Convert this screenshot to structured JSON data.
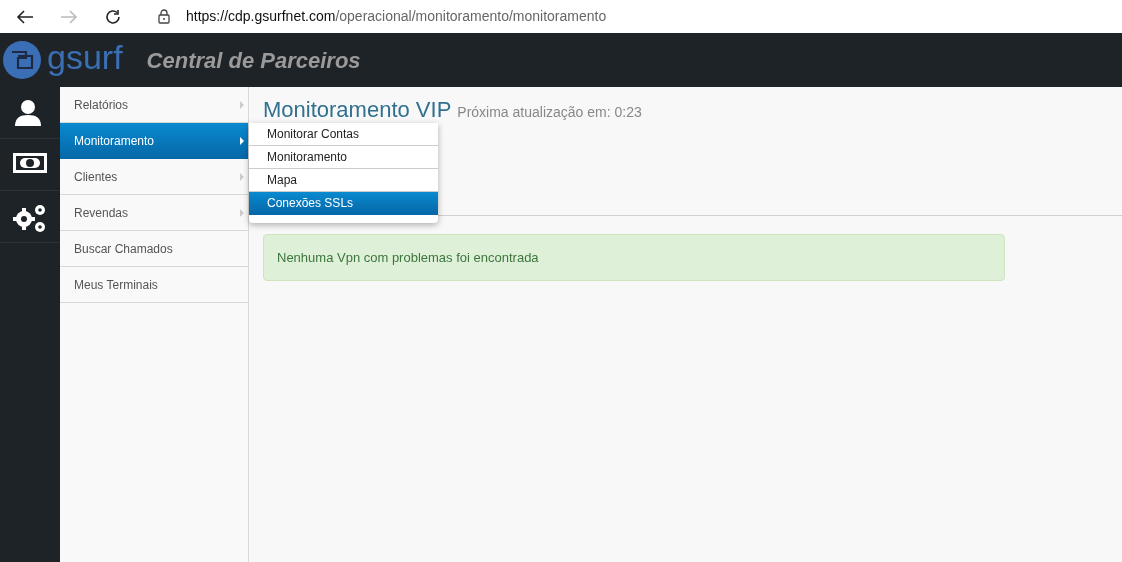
{
  "browser": {
    "url_host": "https://cdp.gsurfnet.com",
    "url_path": "/operacional/monitoramento/monitoramento"
  },
  "header": {
    "logo_text": "gsurf",
    "app_title": "Central de Parceiros"
  },
  "icon_sidebar": [
    {
      "kind": "user",
      "selected": false
    },
    {
      "kind": "money",
      "selected": false
    },
    {
      "kind": "gears",
      "selected": false
    }
  ],
  "menu": [
    {
      "label": "Relatórios",
      "has_submenu": true,
      "selected": false
    },
    {
      "label": "Monitoramento",
      "has_submenu": true,
      "selected": true
    },
    {
      "label": "Clientes",
      "has_submenu": true,
      "selected": false
    },
    {
      "label": "Revendas",
      "has_submenu": true,
      "selected": false
    },
    {
      "label": "Buscar Chamados",
      "has_submenu": false,
      "selected": false
    },
    {
      "label": "Meus Terminais",
      "has_submenu": false,
      "selected": false
    }
  ],
  "submenu": [
    {
      "label": "Monitorar Contas",
      "selected": false
    },
    {
      "label": "Monitoramento",
      "selected": false
    },
    {
      "label": "Mapa",
      "selected": false
    },
    {
      "label": "Conexões SSLs",
      "selected": true
    }
  ],
  "page": {
    "title": "Monitoramento VIP",
    "subtitle": "Próxima atualização em: 0:23",
    "alert": "Nenhuma Vpn com problemas foi encontrada"
  }
}
